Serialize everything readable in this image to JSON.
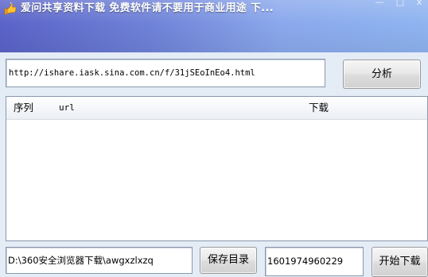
{
  "window": {
    "title": "爱问共享资料下载 免费软件请不要用于商业用途 下...",
    "icon": "share-hand-icon",
    "controls": {
      "minimize": "—",
      "maximize": "□",
      "close": "x"
    },
    "colors": {
      "titlebar_left": "#5a63c8",
      "titlebar_right": "#8fb4f0",
      "background": "#e4ecf6"
    }
  },
  "url_field": {
    "value": "http://ishare.iask.sina.com.cn/f/31jSEoInEo4.html"
  },
  "analyze_button": {
    "label": "分析"
  },
  "list": {
    "columns": [
      "序列",
      "url",
      "下载"
    ],
    "rows": []
  },
  "save_dir": {
    "value": "D:\\360安全浏览器下载\\awgxzlxzq"
  },
  "save_dir_button": {
    "label": "保存目录"
  },
  "number_field": {
    "value": "1601974960229"
  },
  "start_button": {
    "label": "开始下载"
  }
}
